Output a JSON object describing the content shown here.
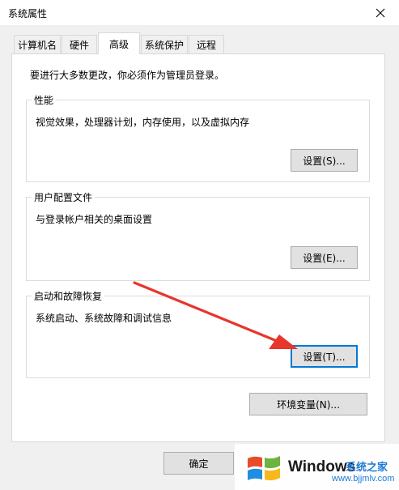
{
  "window": {
    "title": "系统属性"
  },
  "tabs": [
    {
      "label": "计算机名"
    },
    {
      "label": "硬件"
    },
    {
      "label": "高级",
      "active": true
    },
    {
      "label": "系统保护"
    },
    {
      "label": "远程"
    }
  ],
  "intro_text": "要进行大多数更改，你必须作为管理员登录。",
  "performance": {
    "label": "性能",
    "description": "视觉效果，处理器计划，内存使用，以及虚拟内存",
    "button": "设置(S)..."
  },
  "user_profiles": {
    "label": "用户配置文件",
    "description": "与登录帐户相关的桌面设置",
    "button": "设置(E)..."
  },
  "startup_recovery": {
    "label": "启动和故障恢复",
    "description": "系统启动、系统故障和调试信息",
    "button": "设置(T)..."
  },
  "env_button": "环境变量(N)...",
  "ok_button": "确定",
  "arrow_color": "#e8362c",
  "focus_color": "#0078d7",
  "watermark": {
    "brand": "Windows",
    "brand_cn": "系统之家",
    "url": "www.bjjmlv.com"
  }
}
